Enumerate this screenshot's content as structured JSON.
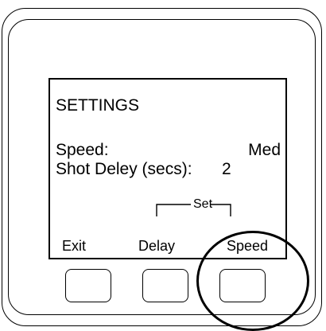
{
  "screen": {
    "title": "SETTINGS",
    "speed_label": "Speed:",
    "speed_value": "Med",
    "delay_label": "Shot Deley (secs):",
    "delay_value": "2"
  },
  "softkeys": {
    "group_label": "Set",
    "exit": "Exit",
    "delay": "Delay",
    "speed": "Speed"
  },
  "highlight_target": "speed-button"
}
